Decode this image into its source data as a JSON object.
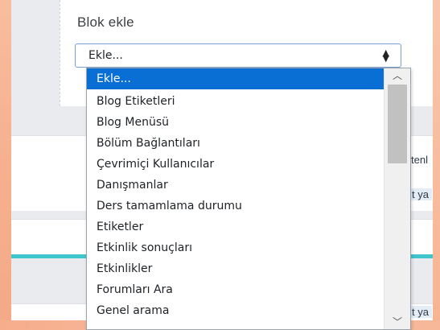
{
  "block_panel": {
    "title": "Blok ekle",
    "select_value": "Ekle..."
  },
  "dropdown": {
    "options": [
      "Ekle...",
      "Blog Etiketleri",
      "Blog Menüsü",
      "Bölüm Bağlantıları",
      "Çevrimiçi Kullanıcılar",
      "Danışmanlar",
      "Ders tamamlama durumu",
      "Etiketler",
      "Etkinlik sonuçları",
      "Etkinlikler",
      "Forumları Ara",
      "Genel arama"
    ],
    "selected_index": 0
  },
  "background": {
    "partial_text_1": "tenl",
    "partial_text_2": "t ya",
    "partial_text_3": "t ya"
  },
  "colors": {
    "selected_option_bg": "#0a6fd4",
    "accent_bar": "#3fc5cc",
    "frame": "#f5c4a8"
  }
}
